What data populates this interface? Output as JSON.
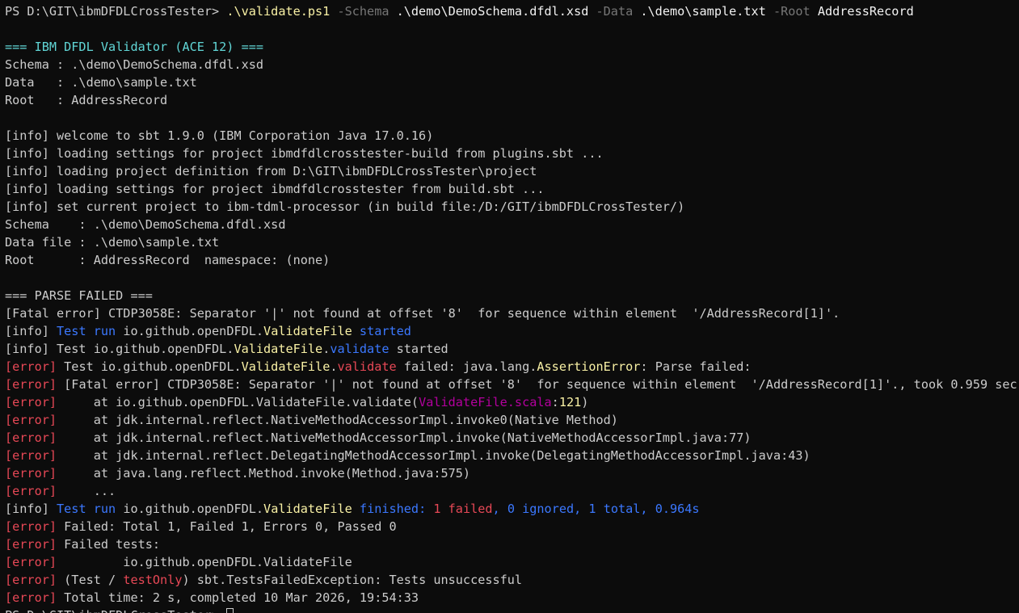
{
  "colors": {
    "background": "#0c0c0c",
    "default_text": "#cccccc",
    "white": "#f2f2f2",
    "yellow": "#f9f1a5",
    "gray": "#767676",
    "cyan": "#61d6d6",
    "blue": "#3b78ff",
    "red": "#e74856",
    "magenta": "#b4009e",
    "bright_yellow": "#f9f1a5"
  },
  "terminal": {
    "lines": [
      [
        {
          "t": "PS D:\\GIT\\ibmDFDLCrossTester> ",
          "c": "default_text"
        },
        {
          "t": ".\\validate.ps1",
          "c": "yellow"
        },
        {
          "t": " -Schema ",
          "c": "gray"
        },
        {
          "t": ".\\demo\\DemoSchema.dfdl.xsd",
          "c": "white"
        },
        {
          "t": " -Data ",
          "c": "gray"
        },
        {
          "t": ".\\demo\\sample.txt",
          "c": "white"
        },
        {
          "t": " -Root ",
          "c": "gray"
        },
        {
          "t": "AddressRecord",
          "c": "white"
        }
      ],
      [],
      [
        {
          "t": "=== IBM DFDL Validator (ACE 12) ===",
          "c": "cyan"
        }
      ],
      [
        {
          "t": "Schema : .\\demo\\DemoSchema.dfdl.xsd",
          "c": "default_text"
        }
      ],
      [
        {
          "t": "Data   : .\\demo\\sample.txt",
          "c": "default_text"
        }
      ],
      [
        {
          "t": "Root   : AddressRecord",
          "c": "default_text"
        }
      ],
      [],
      [
        {
          "t": "[info] welcome to sbt 1.9.0 (IBM Corporation Java 17.0.16)",
          "c": "default_text"
        }
      ],
      [
        {
          "t": "[info] loading settings for project ibmdfdlcrosstester-build from plugins.sbt ...",
          "c": "default_text"
        }
      ],
      [
        {
          "t": "[info] loading project definition from D:\\GIT\\ibmDFDLCrossTester\\project",
          "c": "default_text"
        }
      ],
      [
        {
          "t": "[info] loading settings for project ibmdfdlcrosstester from build.sbt ...",
          "c": "default_text"
        }
      ],
      [
        {
          "t": "[info] set current project to ibm-tdml-processor (in build file:/D:/GIT/ibmDFDLCrossTester/)",
          "c": "default_text"
        }
      ],
      [
        {
          "t": "Schema    : .\\demo\\DemoSchema.dfdl.xsd",
          "c": "default_text"
        }
      ],
      [
        {
          "t": "Data file : .\\demo\\sample.txt",
          "c": "default_text"
        }
      ],
      [
        {
          "t": "Root      : AddressRecord  namespace: (none)",
          "c": "default_text"
        }
      ],
      [],
      [
        {
          "t": "=== PARSE FAILED ===",
          "c": "default_text"
        }
      ],
      [
        {
          "t": "[Fatal error] CTDP3058E: Separator '|' not found at offset '8'  for sequence within element  '/AddressRecord[1]'.",
          "c": "default_text"
        }
      ],
      [
        {
          "t": "[info] ",
          "c": "default_text"
        },
        {
          "t": "Test run ",
          "c": "blue"
        },
        {
          "t": "io.github.openDFDL.",
          "c": "default_text"
        },
        {
          "t": "ValidateFile",
          "c": "yellow"
        },
        {
          "t": " started",
          "c": "blue"
        }
      ],
      [
        {
          "t": "[info] Test io.github.openDFDL.",
          "c": "default_text"
        },
        {
          "t": "ValidateFile",
          "c": "yellow"
        },
        {
          "t": ".",
          "c": "default_text"
        },
        {
          "t": "validate",
          "c": "blue"
        },
        {
          "t": " started",
          "c": "default_text"
        }
      ],
      [
        {
          "t": "[error]",
          "c": "red"
        },
        {
          "t": " Test io.github.openDFDL.",
          "c": "default_text"
        },
        {
          "t": "ValidateFile",
          "c": "yellow"
        },
        {
          "t": ".",
          "c": "default_text"
        },
        {
          "t": "validate",
          "c": "red"
        },
        {
          "t": " failed: java.lang.",
          "c": "default_text"
        },
        {
          "t": "AssertionError",
          "c": "yellow"
        },
        {
          "t": ": Parse failed:",
          "c": "default_text"
        }
      ],
      [
        {
          "t": "[error]",
          "c": "red"
        },
        {
          "t": " [Fatal error] CTDP3058E: Separator '|' not found at offset '8'  for sequence within element  '/AddressRecord[1]'., took 0.959 sec",
          "c": "default_text"
        }
      ],
      [
        {
          "t": "[error]",
          "c": "red"
        },
        {
          "t": "     at io.github.openDFDL.ValidateFile.validate(",
          "c": "default_text"
        },
        {
          "t": "ValidateFile.scala",
          "c": "magenta"
        },
        {
          "t": ":",
          "c": "default_text"
        },
        {
          "t": "121",
          "c": "yellow"
        },
        {
          "t": ")",
          "c": "default_text"
        }
      ],
      [
        {
          "t": "[error]",
          "c": "red"
        },
        {
          "t": "     at jdk.internal.reflect.NativeMethodAccessorImpl.invoke0(Native Method)",
          "c": "default_text"
        }
      ],
      [
        {
          "t": "[error]",
          "c": "red"
        },
        {
          "t": "     at jdk.internal.reflect.NativeMethodAccessorImpl.invoke(NativeMethodAccessorImpl.java:77)",
          "c": "default_text"
        }
      ],
      [
        {
          "t": "[error]",
          "c": "red"
        },
        {
          "t": "     at jdk.internal.reflect.DelegatingMethodAccessorImpl.invoke(DelegatingMethodAccessorImpl.java:43)",
          "c": "default_text"
        }
      ],
      [
        {
          "t": "[error]",
          "c": "red"
        },
        {
          "t": "     at java.lang.reflect.Method.invoke(Method.java:575)",
          "c": "default_text"
        }
      ],
      [
        {
          "t": "[error]",
          "c": "red"
        },
        {
          "t": "     ...",
          "c": "default_text"
        }
      ],
      [
        {
          "t": "[info] ",
          "c": "default_text"
        },
        {
          "t": "Test run ",
          "c": "blue"
        },
        {
          "t": "io.github.openDFDL.",
          "c": "default_text"
        },
        {
          "t": "ValidateFile",
          "c": "yellow"
        },
        {
          "t": " finished: ",
          "c": "blue"
        },
        {
          "t": "1 failed",
          "c": "red"
        },
        {
          "t": ", ",
          "c": "blue"
        },
        {
          "t": "0 ignored",
          "c": "blue"
        },
        {
          "t": ", 1 total, 0.964s",
          "c": "blue"
        }
      ],
      [
        {
          "t": "[error]",
          "c": "red"
        },
        {
          "t": " Failed: Total 1, Failed 1, Errors 0, Passed 0",
          "c": "default_text"
        }
      ],
      [
        {
          "t": "[error]",
          "c": "red"
        },
        {
          "t": " Failed tests:",
          "c": "default_text"
        }
      ],
      [
        {
          "t": "[error]",
          "c": "red"
        },
        {
          "t": "         io.github.openDFDL.ValidateFile",
          "c": "default_text"
        }
      ],
      [
        {
          "t": "[error]",
          "c": "red"
        },
        {
          "t": " (Test / ",
          "c": "default_text"
        },
        {
          "t": "testOnly",
          "c": "red"
        },
        {
          "t": ") sbt.TestsFailedException: Tests unsuccessful",
          "c": "default_text"
        }
      ],
      [
        {
          "t": "[error]",
          "c": "red"
        },
        {
          "t": " Total time: 2 s, completed 10 Mar 2026, 19:54:33",
          "c": "default_text"
        }
      ],
      [
        {
          "t": "PS D:\\GIT\\ibmDFDLCrossTester> ",
          "c": "default_text"
        }
      ]
    ]
  }
}
